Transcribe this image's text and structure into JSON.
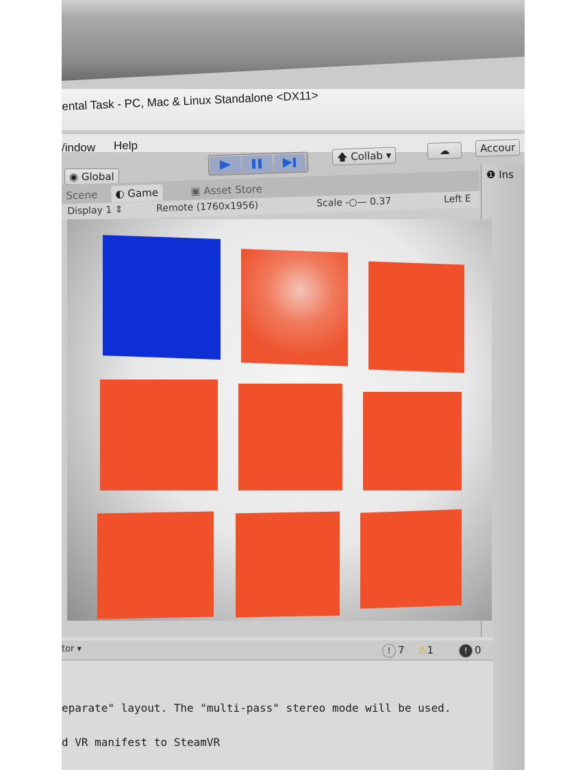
{
  "window": {
    "title": "ental Task - PC, Mac & Linux Standalone <DX11>"
  },
  "menu": {
    "items": [
      "/indow",
      "Help"
    ]
  },
  "toolbar": {
    "global_label": "Global",
    "collab_label": "Collab",
    "account_label": "Accour"
  },
  "tabs": [
    {
      "label": "Scene"
    },
    {
      "label": "Game"
    },
    {
      "label": "Asset Store"
    }
  ],
  "inspector": {
    "tab_label": "Ins"
  },
  "game_view": {
    "display": "Display 1",
    "resolution": "Remote (1760x1956)",
    "scale_label": "Scale",
    "scale_value": "0.37",
    "left_eye": "Left E"
  },
  "grid": {
    "colors": {
      "tile": "#f0502a",
      "selected": "#0f2fd6"
    },
    "tiles": [
      {
        "row": 1,
        "col": 1,
        "state": "selected"
      },
      {
        "row": 1,
        "col": 2,
        "state": "highlighted"
      },
      {
        "row": 1,
        "col": 3,
        "state": "normal"
      },
      {
        "row": 2,
        "col": 1,
        "state": "normal"
      },
      {
        "row": 2,
        "col": 2,
        "state": "normal"
      },
      {
        "row": 2,
        "col": 3,
        "state": "normal"
      },
      {
        "row": 3,
        "col": 1,
        "state": "normal"
      },
      {
        "row": 3,
        "col": 2,
        "state": "normal"
      },
      {
        "row": 3,
        "col": 3,
        "state": "normal"
      }
    ]
  },
  "console": {
    "tab_label": "tor",
    "counts": {
      "logs": "7",
      "warnings": "1",
      "errors": "0"
    },
    "lines": [
      "eparate\" layout. The \"multi-pass\" stereo mode will be used.",
      "d VR manifest to SteamVR"
    ]
  }
}
